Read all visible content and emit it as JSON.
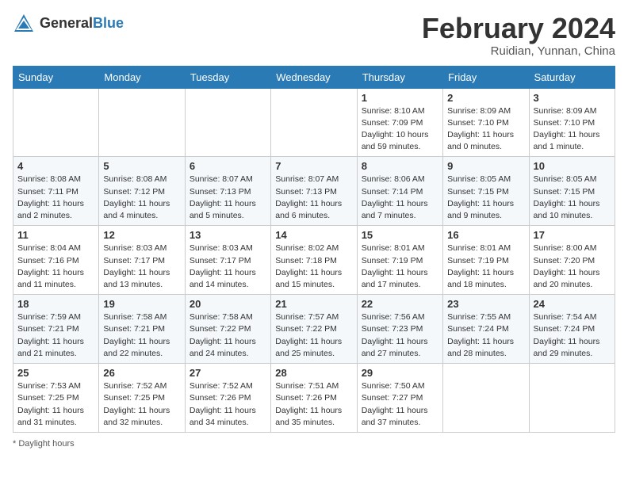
{
  "header": {
    "logo_general": "General",
    "logo_blue": "Blue",
    "title": "February 2024",
    "subtitle": "Ruidian, Yunnan, China"
  },
  "days_of_week": [
    "Sunday",
    "Monday",
    "Tuesday",
    "Wednesday",
    "Thursday",
    "Friday",
    "Saturday"
  ],
  "weeks": [
    [
      {
        "day": "",
        "info": ""
      },
      {
        "day": "",
        "info": ""
      },
      {
        "day": "",
        "info": ""
      },
      {
        "day": "",
        "info": ""
      },
      {
        "day": "1",
        "info": "Sunrise: 8:10 AM\nSunset: 7:09 PM\nDaylight: 10 hours and 59 minutes."
      },
      {
        "day": "2",
        "info": "Sunrise: 8:09 AM\nSunset: 7:10 PM\nDaylight: 11 hours and 0 minutes."
      },
      {
        "day": "3",
        "info": "Sunrise: 8:09 AM\nSunset: 7:10 PM\nDaylight: 11 hours and 1 minute."
      }
    ],
    [
      {
        "day": "4",
        "info": "Sunrise: 8:08 AM\nSunset: 7:11 PM\nDaylight: 11 hours and 2 minutes."
      },
      {
        "day": "5",
        "info": "Sunrise: 8:08 AM\nSunset: 7:12 PM\nDaylight: 11 hours and 4 minutes."
      },
      {
        "day": "6",
        "info": "Sunrise: 8:07 AM\nSunset: 7:13 PM\nDaylight: 11 hours and 5 minutes."
      },
      {
        "day": "7",
        "info": "Sunrise: 8:07 AM\nSunset: 7:13 PM\nDaylight: 11 hours and 6 minutes."
      },
      {
        "day": "8",
        "info": "Sunrise: 8:06 AM\nSunset: 7:14 PM\nDaylight: 11 hours and 7 minutes."
      },
      {
        "day": "9",
        "info": "Sunrise: 8:05 AM\nSunset: 7:15 PM\nDaylight: 11 hours and 9 minutes."
      },
      {
        "day": "10",
        "info": "Sunrise: 8:05 AM\nSunset: 7:15 PM\nDaylight: 11 hours and 10 minutes."
      }
    ],
    [
      {
        "day": "11",
        "info": "Sunrise: 8:04 AM\nSunset: 7:16 PM\nDaylight: 11 hours and 11 minutes."
      },
      {
        "day": "12",
        "info": "Sunrise: 8:03 AM\nSunset: 7:17 PM\nDaylight: 11 hours and 13 minutes."
      },
      {
        "day": "13",
        "info": "Sunrise: 8:03 AM\nSunset: 7:17 PM\nDaylight: 11 hours and 14 minutes."
      },
      {
        "day": "14",
        "info": "Sunrise: 8:02 AM\nSunset: 7:18 PM\nDaylight: 11 hours and 15 minutes."
      },
      {
        "day": "15",
        "info": "Sunrise: 8:01 AM\nSunset: 7:19 PM\nDaylight: 11 hours and 17 minutes."
      },
      {
        "day": "16",
        "info": "Sunrise: 8:01 AM\nSunset: 7:19 PM\nDaylight: 11 hours and 18 minutes."
      },
      {
        "day": "17",
        "info": "Sunrise: 8:00 AM\nSunset: 7:20 PM\nDaylight: 11 hours and 20 minutes."
      }
    ],
    [
      {
        "day": "18",
        "info": "Sunrise: 7:59 AM\nSunset: 7:21 PM\nDaylight: 11 hours and 21 minutes."
      },
      {
        "day": "19",
        "info": "Sunrise: 7:58 AM\nSunset: 7:21 PM\nDaylight: 11 hours and 22 minutes."
      },
      {
        "day": "20",
        "info": "Sunrise: 7:58 AM\nSunset: 7:22 PM\nDaylight: 11 hours and 24 minutes."
      },
      {
        "day": "21",
        "info": "Sunrise: 7:57 AM\nSunset: 7:22 PM\nDaylight: 11 hours and 25 minutes."
      },
      {
        "day": "22",
        "info": "Sunrise: 7:56 AM\nSunset: 7:23 PM\nDaylight: 11 hours and 27 minutes."
      },
      {
        "day": "23",
        "info": "Sunrise: 7:55 AM\nSunset: 7:24 PM\nDaylight: 11 hours and 28 minutes."
      },
      {
        "day": "24",
        "info": "Sunrise: 7:54 AM\nSunset: 7:24 PM\nDaylight: 11 hours and 29 minutes."
      }
    ],
    [
      {
        "day": "25",
        "info": "Sunrise: 7:53 AM\nSunset: 7:25 PM\nDaylight: 11 hours and 31 minutes."
      },
      {
        "day": "26",
        "info": "Sunrise: 7:52 AM\nSunset: 7:25 PM\nDaylight: 11 hours and 32 minutes."
      },
      {
        "day": "27",
        "info": "Sunrise: 7:52 AM\nSunset: 7:26 PM\nDaylight: 11 hours and 34 minutes."
      },
      {
        "day": "28",
        "info": "Sunrise: 7:51 AM\nSunset: 7:26 PM\nDaylight: 11 hours and 35 minutes."
      },
      {
        "day": "29",
        "info": "Sunrise: 7:50 AM\nSunset: 7:27 PM\nDaylight: 11 hours and 37 minutes."
      },
      {
        "day": "",
        "info": ""
      },
      {
        "day": "",
        "info": ""
      }
    ]
  ],
  "footer": {
    "note": "Daylight hours"
  }
}
